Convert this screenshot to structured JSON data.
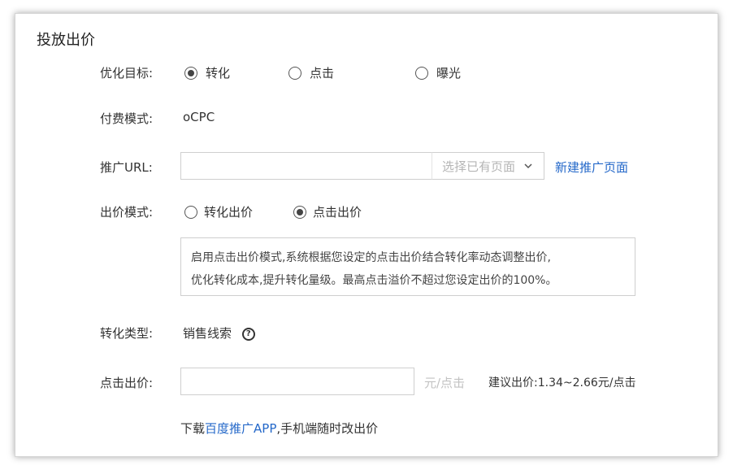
{
  "section": {
    "title": "投放出价"
  },
  "optimization": {
    "label": "优化目标:",
    "options": [
      {
        "label": "转化",
        "selected": true
      },
      {
        "label": "点击",
        "selected": false
      },
      {
        "label": "曝光",
        "selected": false
      }
    ]
  },
  "payment": {
    "label": "付费模式:",
    "value": "oCPC"
  },
  "promo_url": {
    "label": "推广URL:",
    "value": "",
    "select_placeholder": "选择已有页面",
    "new_page_link": "新建推广页面"
  },
  "bid_mode": {
    "label": "出价模式:",
    "options": [
      {
        "label": "转化出价",
        "selected": false
      },
      {
        "label": "点击出价",
        "selected": true
      }
    ],
    "info_line1": "启用点击出价模式,系统根据您设定的点击出价结合转化率动态调整出价,",
    "info_line2": "优化转化成本,提升转化量级。最高点击溢价不超过您设定出价的100%。"
  },
  "conversion_type": {
    "label": "转化类型:",
    "value": "销售线索",
    "help_icon": "question-circle-icon"
  },
  "click_bid": {
    "label": "点击出价:",
    "value": "",
    "unit": "元/点击",
    "suggestion": "建议出价:1.34~2.66元/点击"
  },
  "app_note": {
    "prefix": "下载",
    "link": "百度推广APP",
    "suffix": ",手机端随时改出价"
  },
  "colors": {
    "link": "#2468c9",
    "border": "#cfcfcf",
    "placeholder": "#b5b5b5"
  }
}
